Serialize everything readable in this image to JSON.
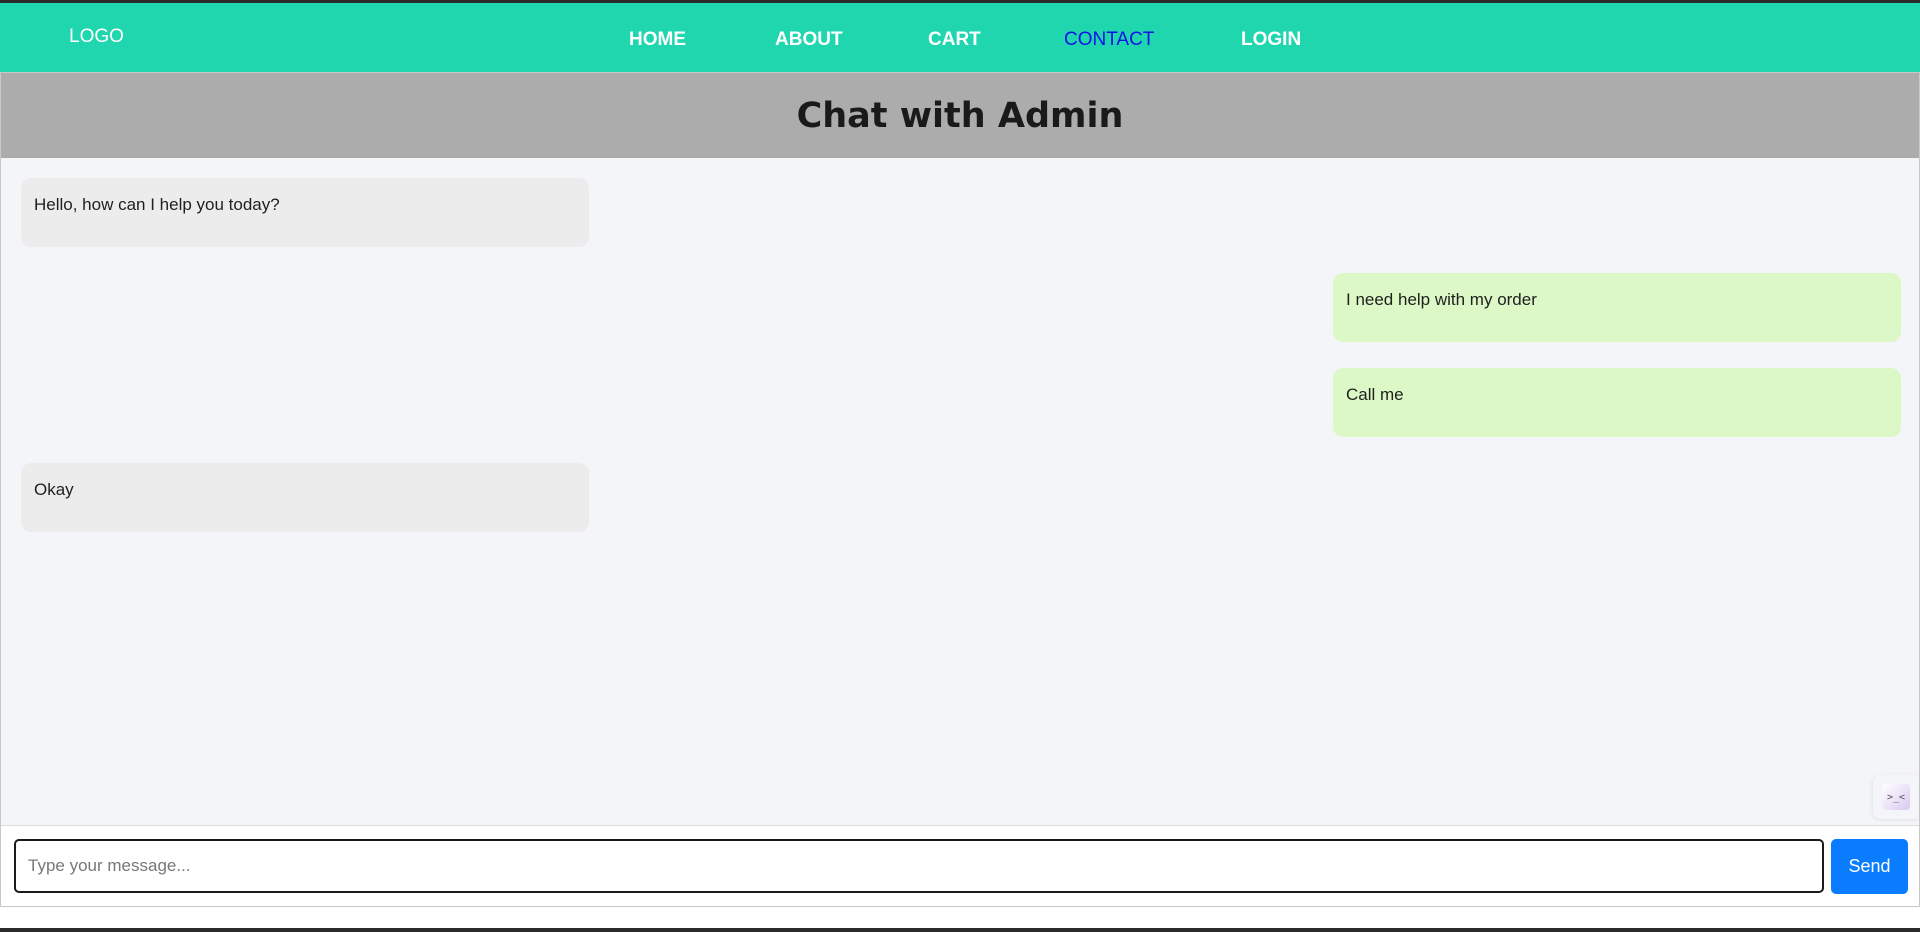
{
  "nav": {
    "logo": "LOGO",
    "links": [
      {
        "label": "HOME"
      },
      {
        "label": "ABOUT"
      },
      {
        "label": "CART"
      },
      {
        "label": "CONTACT"
      },
      {
        "label": "LOGIN"
      }
    ],
    "active": "CONTACT",
    "colors": {
      "bar": "#1fd6ae",
      "link": "#ffffff",
      "active_link": "#1212e8"
    }
  },
  "chat": {
    "title": "Chat with Admin",
    "messages": [
      {
        "sender": "admin",
        "text": "Hello, how can I help you today?"
      },
      {
        "sender": "user",
        "text": "I need help with my order"
      },
      {
        "sender": "user",
        "text": "Call me"
      },
      {
        "sender": "admin",
        "text": "Okay"
      }
    ],
    "colors": {
      "admin_bubble": "#ececec",
      "user_bubble": "#dcf8c6",
      "header": "#abacab"
    }
  },
  "composer": {
    "placeholder": "Type your message...",
    "value": "",
    "send_label": "Send",
    "send_color": "#0a7cff"
  },
  "widget": {
    "icon": "floating-assistant-icon",
    "glyph": ">_<"
  }
}
